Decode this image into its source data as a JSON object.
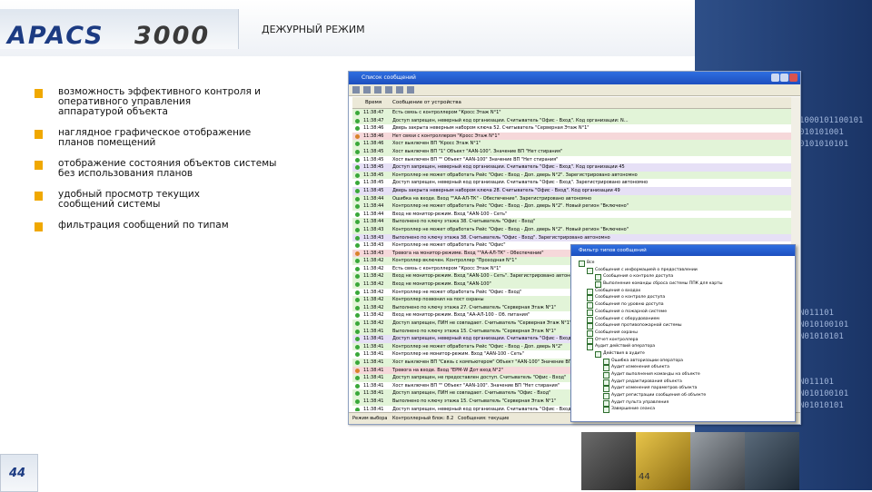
{
  "header": {
    "logo_word": "APACS",
    "logo_number": "3000",
    "title": "ДЕЖУРНЫЙ РЕЖИМ"
  },
  "bullets": [
    "возможность  эффективного контроля и\nоперативного управления\nаппаратурой объекта",
    "наглядное графическое отображение\nпланов помещений",
    "отображение состояния объектов системы\nбез использования планов",
    "удобный просмотр текущих\nсообщений системы",
    "фильтрация сообщений по типам"
  ],
  "side_binary": [
    "1000101100101",
    "010101001",
    "0101010101",
    "N011101",
    "N010100101",
    "N01010101",
    "N011101",
    "N010100101",
    "N01010101"
  ],
  "messages_window": {
    "title": "Список сообщений",
    "col_time": "Время",
    "col_message": "Сообщение от устройства",
    "rows": [
      {
        "time": "11:38:47",
        "msg": "Есть связь с контроллером \"Кросс Этаж N°1\"",
        "color": "#e2f4d8",
        "icon": "#3aa83a"
      },
      {
        "time": "11:38:47",
        "msg": "Доступ запрещен, неверный код организации. Считыватель \"Офис - Вход\". Код организации: N...",
        "color": "#e2f4d8",
        "icon": "#3aa83a"
      },
      {
        "time": "11:38:46",
        "msg": "Дверь закрыта неверным набором ключа 52. Считыватель \"Серверная Этаж N°1\"",
        "color": "#ffffff",
        "icon": "#3aa83a"
      },
      {
        "time": "11:38:46",
        "msg": "Нет связи с контроллером \"Кросс Этаж N°1\"",
        "color": "#f6d8da",
        "icon": "#d9822b"
      },
      {
        "time": "11:38:46",
        "msg": "Хост выключен ВП \"Кросс Этаж N°1\"",
        "color": "#e2f4d8",
        "icon": "#3aa83a"
      },
      {
        "time": "11:38:45",
        "msg": "Хост выключен ВП \"1\" Объект \"AAN-100\". Значение ВП \"Нет стирания\"",
        "color": "#e2f4d8",
        "icon": "#3aa83a"
      },
      {
        "time": "11:38:45",
        "msg": "Хост выключен ВП \"\" Объект \"AAN-100\" Значение ВП \"Нет стирания\"",
        "color": "#ffffff",
        "icon": "#3aa83a"
      },
      {
        "time": "11:38:45",
        "msg": "Доступ запрещен, неверный код организации. Считыватель \"Офис - Вход\". Код организации 45",
        "color": "#e6e0f6",
        "icon": "#3aa83a"
      },
      {
        "time": "11:38:45",
        "msg": "Контроллер не может обработать Рейс \"Офис - Вход - Доп. дверь N°2\". Зарегистрировано автономно",
        "color": "#e2f4d8",
        "icon": "#3aa83a"
      },
      {
        "time": "11:38:45",
        "msg": "Доступ запрещен, неверный код организации. Считыватель \"Офис - Вход\". Зарегистрировано автономно",
        "color": "#ffffff",
        "icon": "#3aa83a"
      },
      {
        "time": "11:38:45",
        "msg": "Дверь закрыта неверным набором ключа 28. Считыватель \"Офис - Вход\". Код организации 49",
        "color": "#e6e0f6",
        "icon": "#3aa83a"
      },
      {
        "time": "11:38:44",
        "msg": "Ошибка на входе. Вход \"\"AA-АЛ-ТК\" - Обеспечение\". Зарегистрировано автономно",
        "color": "#e2f4d8",
        "icon": "#3aa83a"
      },
      {
        "time": "11:38:44",
        "msg": "Контроллер не может обработать Рейс \"Офис - Вход - Доп. дверь N°2\". Новый регион \"Включено\"",
        "color": "#e2f4d8",
        "icon": "#3aa83a"
      },
      {
        "time": "11:38:44",
        "msg": "Вход не монитор-режим. Вход \"AAN-100 - Сеть\"",
        "color": "#ffffff",
        "icon": "#3aa83a"
      },
      {
        "time": "11:38:44",
        "msg": "Выполнено по ключу этажа 38. Считыватель \"Офис - Вход\"",
        "color": "#e2f4d8",
        "icon": "#3aa83a"
      },
      {
        "time": "11:38:43",
        "msg": "Контроллер не может обработать Рейс \"Офис - Вход - Доп. дверь N°2\". Новый регион \"Включено\"",
        "color": "#e2f4d8",
        "icon": "#3aa83a"
      },
      {
        "time": "11:38:43",
        "msg": "Выполнено по ключу этажа 38. Считыватель \"Офис - Вход\". Зарегистрировано автономно",
        "color": "#e6e0f6",
        "icon": "#3aa83a"
      },
      {
        "time": "11:38:43",
        "msg": "Контроллер не может обработать Рейс \"Офис\"",
        "color": "#ffffff",
        "icon": "#3aa83a"
      },
      {
        "time": "11:38:43",
        "msg": "Тревога на монитор-режиме. Вход \"\"AA-АЛ-ТК\" - Обеспечение\"",
        "color": "#f6d8da",
        "icon": "#d9822b"
      },
      {
        "time": "11:38:42",
        "msg": "Контроллер включен. Контроллер \"Проходная N°1\"",
        "color": "#e2f4d8",
        "icon": "#3aa83a"
      },
      {
        "time": "11:38:42",
        "msg": "Есть связь с контроллером \"Кросс Этаж N°1\"",
        "color": "#ffffff",
        "icon": "#3aa83a"
      },
      {
        "time": "11:38:42",
        "msg": "Вход не монитор-режим. Вход \"AAN-100 - Сеть\". Зарегистрировано автономно",
        "color": "#e2f4d8",
        "icon": "#3aa83a"
      },
      {
        "time": "11:38:42",
        "msg": "Вход не монитор-режим. Вход \"AAN-100\"",
        "color": "#e2f4d8",
        "icon": "#3aa83a"
      },
      {
        "time": "11:38:42",
        "msg": "Контроллер не может обработать Рейс \"Офис - Вход\"",
        "color": "#ffffff",
        "icon": "#3aa83a"
      },
      {
        "time": "11:38:42",
        "msg": "Контроллер позвонил на пост охраны",
        "color": "#e2f4d8",
        "icon": "#3aa83a"
      },
      {
        "time": "11:38:42",
        "msg": "Выполнено по ключу этажа 27. Считыватель \"Серверная Этаж N°1\"",
        "color": "#e2f4d8",
        "icon": "#3aa83a"
      },
      {
        "time": "11:38:42",
        "msg": "Вход не монитор-режим. Вход \"AA-АЛ-100 - Об. питания\"",
        "color": "#ffffff",
        "icon": "#3aa83a"
      },
      {
        "time": "11:38:42",
        "msg": "Доступ запрещен, ПИН не совпадает. Считыватель \"Серверная Этаж N°1\"",
        "color": "#e2f4d8",
        "icon": "#3aa83a"
      },
      {
        "time": "11:38:41",
        "msg": "Выполнено по ключу этажа 15. Считыватель \"Серверная Этаж N°1\"",
        "color": "#e2f4d8",
        "icon": "#3aa83a"
      },
      {
        "time": "11:38:41",
        "msg": "Доступ запрещен, неверный код организации. Считыватель \"Офис - Вход\"",
        "color": "#e6e0f6",
        "icon": "#3aa83a"
      },
      {
        "time": "11:38:41",
        "msg": "Контроллер не может обработать Рейс \"Офис - Вход - Доп. дверь N°2\"",
        "color": "#e2f4d8",
        "icon": "#3aa83a"
      },
      {
        "time": "11:38:41",
        "msg": "Контроллер не монитор-режим. Вход \"AAN-100 - Сеть\"",
        "color": "#ffffff",
        "icon": "#3aa83a"
      },
      {
        "time": "11:38:41",
        "msg": "Хост выключен ВП \"Связь с компьютером\" Объект \"AAN-100\" Значение ВП \"Нет стирания\"",
        "color": "#e2f4d8",
        "icon": "#3aa83a"
      },
      {
        "time": "11:38:41",
        "msg": "Тревога на входе. Вход \"ЕРМ-W Дот вход N°2\"",
        "color": "#f6d8da",
        "icon": "#d9822b"
      },
      {
        "time": "11:38:41",
        "msg": "Доступ запрещен, не предоставлен доступ. Считыватель \"Офис - Вход\"",
        "color": "#e2f4d8",
        "icon": "#3aa83a"
      },
      {
        "time": "11:38:41",
        "msg": "Хост выключен ВП \"\" Объект \"AAN-100\". Значение ВП \"Нет стирания\"",
        "color": "#ffffff",
        "icon": "#3aa83a"
      },
      {
        "time": "11:38:41",
        "msg": "Доступ запрещен, ПИН не совпадает. Считыватель \"Офис - Вход\"",
        "color": "#e2f4d8",
        "icon": "#3aa83a"
      },
      {
        "time": "11:38:41",
        "msg": "Выполнено по ключу этажа 15. Считыватель \"Серверная Этаж N°1\"",
        "color": "#e2f4d8",
        "icon": "#3aa83a"
      },
      {
        "time": "11:38:41",
        "msg": "Доступ запрещен, неверный код организации. Считыватель \"Офис - Вход\"",
        "color": "#ffffff",
        "icon": "#3aa83a"
      },
      {
        "time": "11:38:41",
        "msg": "Контроллер не может обработать Рейс \"Офис - Вход\"",
        "color": "#e2f4d8",
        "icon": "#3aa83a"
      },
      {
        "time": "11:38:41",
        "msg": "Вход не монитор-режим. Вход \"Офис - Вход - Доп. вход N°2\"",
        "color": "#e2f4d8",
        "icon": "#3aa83a"
      },
      {
        "time": "11:38:41",
        "msg": "Выполнено по ключу этажа 38. Считыватель \"Офис - Вход\"",
        "color": "#ffffff",
        "icon": "#3aa83a"
      }
    ],
    "status": {
      "mode": "Режим выбора",
      "ctrl": "Контроллерный блок: 8.2",
      "msgs": "Сообщения: текущие"
    }
  },
  "filter_window": {
    "title": "Фильтр типов сообщений",
    "nodes": [
      {
        "label": "Все",
        "level": 0
      },
      {
        "label": "Сообщения с информацией о предоставлении",
        "level": 1
      },
      {
        "label": "Сообщения о контроле доступа",
        "level": 2
      },
      {
        "label": "Выполнение команды сброса системы ППК для карты",
        "level": 2
      },
      {
        "label": "Сообщения о входах",
        "level": 1
      },
      {
        "label": "Сообщения о контроле доступа",
        "level": 1
      },
      {
        "label": "Сообщения по уровню доступа",
        "level": 1
      },
      {
        "label": "Сообщения о пожарной системе",
        "level": 1
      },
      {
        "label": "Сообщения с оборудованием",
        "level": 1
      },
      {
        "label": "Сообщения противопожарной системы",
        "level": 1
      },
      {
        "label": "Сообщения охраны",
        "level": 1
      },
      {
        "label": "Отчет контроллера",
        "level": 1
      },
      {
        "label": "Аудит действий оператора",
        "level": 1
      },
      {
        "label": "Действия в аудите",
        "level": 2
      },
      {
        "label": "Ошибка авторизации оператора",
        "level": 3
      },
      {
        "label": "Аудит изменения объекта",
        "level": 3
      },
      {
        "label": "Аудит выполнения команды на объекте",
        "level": 3
      },
      {
        "label": "Аудит редактирования объекта",
        "level": 3
      },
      {
        "label": "Аудит изменения параметров объекта",
        "level": 3
      },
      {
        "label": "Аудит регистрации сообщения об объекте",
        "level": 3
      },
      {
        "label": "Аудит пульта управления",
        "level": 3
      },
      {
        "label": "Завершение сеанса",
        "level": 3
      }
    ]
  },
  "footer": {
    "page_number": "44",
    "page_number_small": "44"
  }
}
